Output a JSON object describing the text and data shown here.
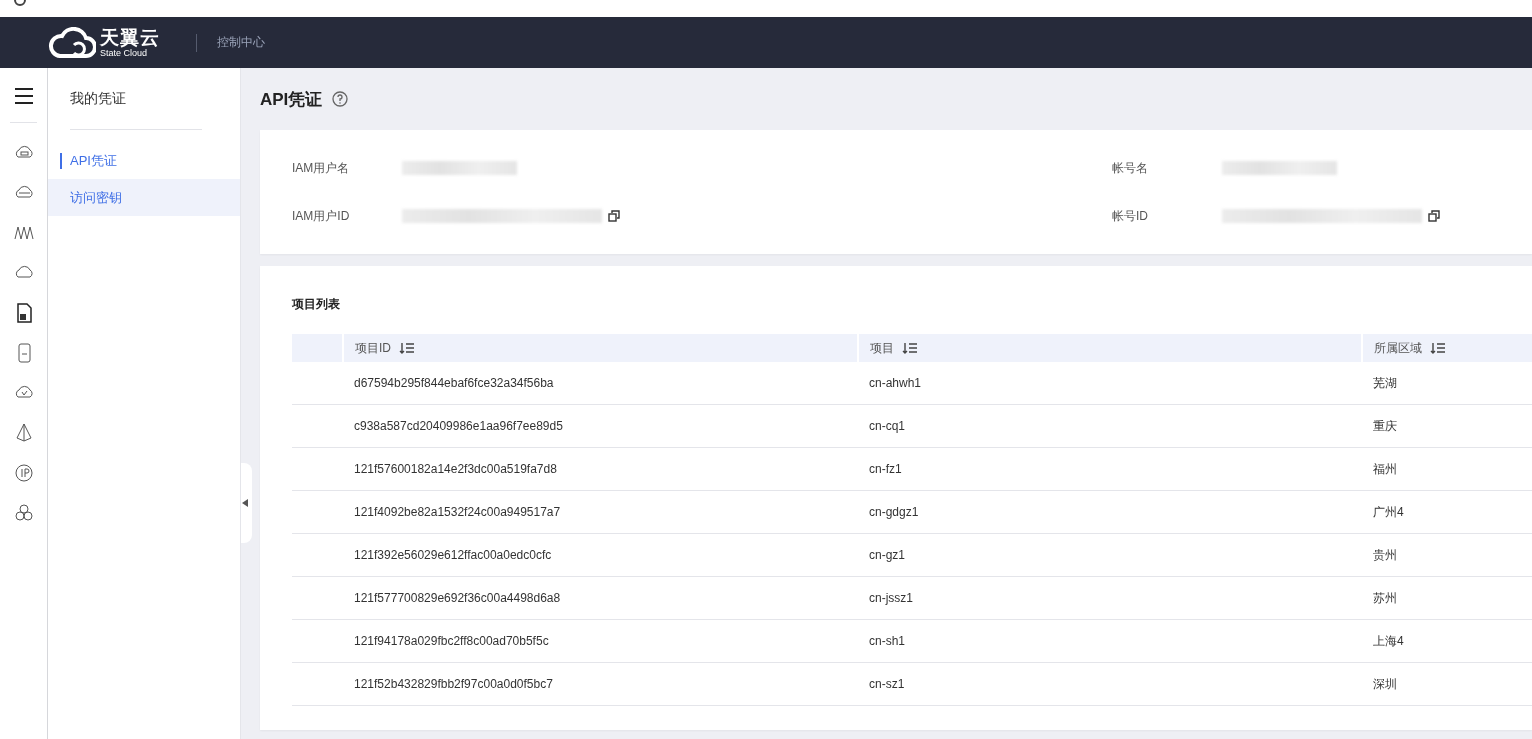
{
  "header": {
    "brand": "天翼云",
    "brand_sub": "State Cloud",
    "console": "控制中心"
  },
  "sidebar": {
    "title": "我的凭证",
    "items": [
      {
        "label": "API凭证",
        "selected": true,
        "highlighted": false
      },
      {
        "label": "访问密钥",
        "selected": false,
        "highlighted": true
      }
    ]
  },
  "page": {
    "title": "API凭证"
  },
  "credentials": [
    {
      "label": "IAM用户名",
      "copyable": false
    },
    {
      "label": "帐号名",
      "copyable": false
    },
    {
      "label": "IAM用户ID",
      "copyable": true
    },
    {
      "label": "帐号ID",
      "copyable": true
    }
  ],
  "projects": {
    "title": "项目列表",
    "columns": [
      {
        "label": "项目ID",
        "sortable": true
      },
      {
        "label": "项目",
        "sortable": true
      },
      {
        "label": "所属区域",
        "sortable": true
      }
    ],
    "rows": [
      {
        "id": "d67594b295f844ebaf6fce32a34f56ba",
        "project": "cn-ahwh1",
        "region": "芜湖"
      },
      {
        "id": "c938a587cd20409986e1aa96f7ee89d5",
        "project": "cn-cq1",
        "region": "重庆"
      },
      {
        "id": "121f57600182a14e2f3dc00a519fa7d8",
        "project": "cn-fz1",
        "region": "福州"
      },
      {
        "id": "121f4092be82a1532f24c00a949517a7",
        "project": "cn-gdgz1",
        "region": "广州4"
      },
      {
        "id": "121f392e56029e612ffac00a0edc0cfc",
        "project": "cn-gz1",
        "region": "贵州"
      },
      {
        "id": "121f577700829e692f36c00a4498d6a8",
        "project": "cn-jssz1",
        "region": "苏州"
      },
      {
        "id": "121f94178a029fbc2ff8c00ad70b5f5c",
        "project": "cn-sh1",
        "region": "上海4"
      },
      {
        "id": "121f52b432829fbb2f97c00a0d0f5bc7",
        "project": "cn-sz1",
        "region": "深圳"
      }
    ]
  }
}
